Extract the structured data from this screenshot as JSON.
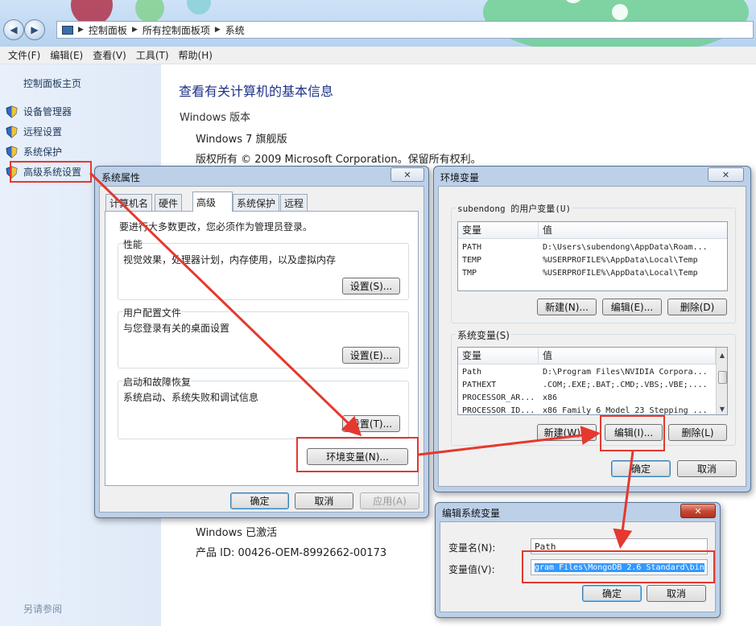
{
  "addressbar": {
    "crumbs": [
      "控制面板",
      "所有控制面板项",
      "系统"
    ]
  },
  "menubar": [
    "文件(F)",
    "编辑(E)",
    "查看(V)",
    "工具(T)",
    "帮助(H)"
  ],
  "sidebar": {
    "home": "控制面板主页",
    "items": [
      {
        "label": "设备管理器",
        "icon": "shield-icon"
      },
      {
        "label": "远程设置",
        "icon": "shield-icon"
      },
      {
        "label": "系统保护",
        "icon": "shield-icon"
      },
      {
        "label": "高级系统设置",
        "icon": "shield-icon"
      }
    ],
    "see_also": "另请参阅"
  },
  "main": {
    "title": "查看有关计算机的基本信息",
    "windows_version_heading": "Windows 版本",
    "edition": "Windows 7 旗舰版",
    "copyright": "版权所有 © 2009 Microsoft Corporation。保留所有权利。",
    "activation": "Windows 已激活",
    "product_id": "产品 ID: 00426-OEM-8992662-00173"
  },
  "system_properties": {
    "title": "系统属性",
    "close": "✕",
    "tabs": [
      "计算机名",
      "硬件",
      "高级",
      "系统保护",
      "远程"
    ],
    "active_tab": "高级",
    "admin_note": "要进行大多数更改，您必须作为管理员登录。",
    "groups": [
      {
        "label": "性能",
        "desc": "视觉效果，处理器计划，内存使用，以及虚拟内存",
        "button": "设置(S)..."
      },
      {
        "label": "用户配置文件",
        "desc": "与您登录有关的桌面设置",
        "button": "设置(E)..."
      },
      {
        "label": "启动和故障恢复",
        "desc": "系统启动、系统失败和调试信息",
        "button": "设置(T)..."
      }
    ],
    "env_button": "环境变量(N)...",
    "ok": "确定",
    "cancel": "取消",
    "apply": "应用(A)"
  },
  "env_vars": {
    "title": "环境变量",
    "close": "✕",
    "user_group": "subendong 的用户变量(U)",
    "col_var": "变量",
    "col_val": "值",
    "user_rows": [
      {
        "name": "PATH",
        "value": "D:\\Users\\subendong\\AppData\\Roam..."
      },
      {
        "name": "TEMP",
        "value": "%USERPROFILE%\\AppData\\Local\\Temp"
      },
      {
        "name": "TMP",
        "value": "%USERPROFILE%\\AppData\\Local\\Temp"
      }
    ],
    "user_buttons": {
      "new": "新建(N)...",
      "edit": "编辑(E)...",
      "delete": "删除(D)"
    },
    "system_group": "系统变量(S)",
    "system_rows": [
      {
        "name": "Path",
        "value": "D:\\Program Files\\NVIDIA Corpora..."
      },
      {
        "name": "PATHEXT",
        "value": ".COM;.EXE;.BAT;.CMD;.VBS;.VBE;...."
      },
      {
        "name": "PROCESSOR_AR...",
        "value": "x86"
      },
      {
        "name": "PROCESSOR_ID...",
        "value": "x86 Family 6 Model 23 Stepping ..."
      }
    ],
    "system_buttons": {
      "new": "新建(W)...",
      "edit": "编辑(I)...",
      "delete": "删除(L)"
    },
    "ok": "确定",
    "cancel": "取消"
  },
  "edit_var": {
    "title": "编辑系统变量",
    "close": "✕",
    "name_label": "变量名(N):",
    "name_value": "Path",
    "value_label": "变量值(V):",
    "value_value": "gram Files\\MongoDB 2.6 Standard\\bin",
    "ok": "确定",
    "cancel": "取消"
  },
  "annotation_color": "#e5382e"
}
